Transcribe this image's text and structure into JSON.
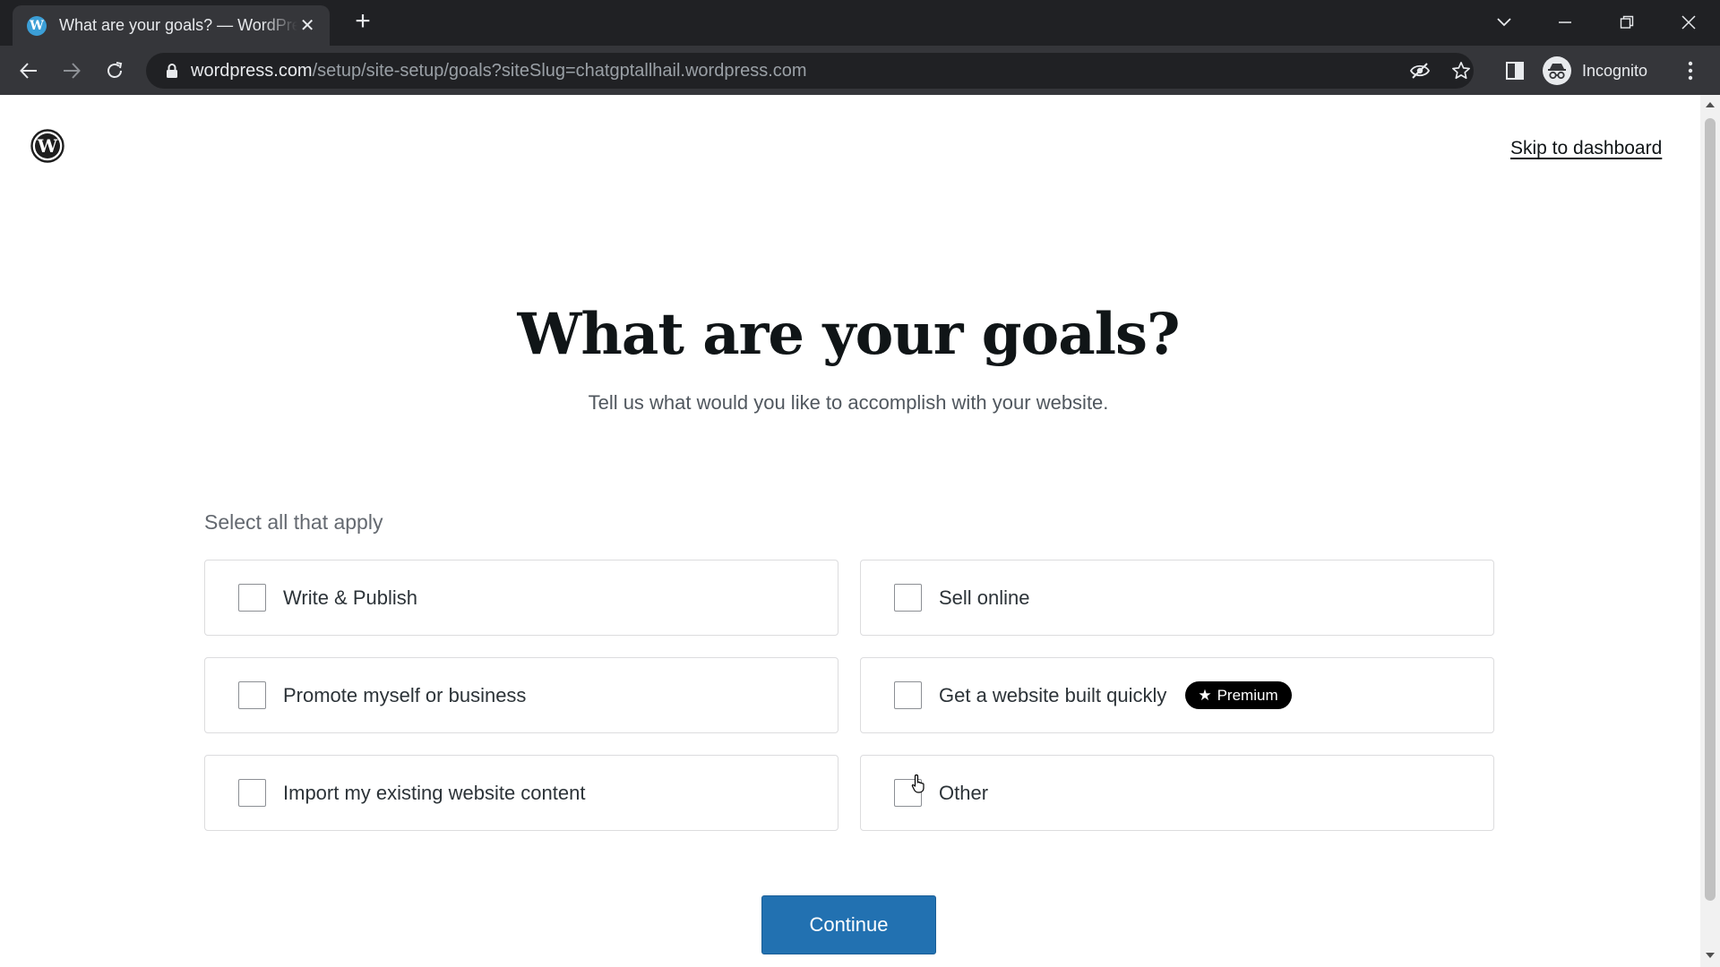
{
  "browser": {
    "tab_title": "What are your goals? — WordPress.com",
    "tab_favicon_letter": "W",
    "url_host": "wordpress.com",
    "url_path": "/setup/site-setup/goals?siteSlug=chatgptallhail.wordpress.com",
    "profile_label": "Incognito",
    "icons": [
      "back-icon",
      "forward-icon",
      "reload-icon",
      "lock-icon",
      "eye-off-icon",
      "star-icon",
      "side-panel-icon",
      "incognito-icon",
      "menu-dots-icon"
    ]
  },
  "header": {
    "skip_label": "Skip to dashboard"
  },
  "main": {
    "title": "What are your goals?",
    "subtitle": "Tell us what would you like to accomplish with your website.",
    "select_label": "Select all that apply",
    "options": [
      {
        "label": "Write & Publish",
        "checked": false
      },
      {
        "label": "Sell online",
        "checked": false
      },
      {
        "label": "Promote myself or business",
        "checked": false
      },
      {
        "label": "Get a website built quickly",
        "checked": false,
        "badge": "Premium"
      },
      {
        "label": "Import my existing website content",
        "checked": false
      },
      {
        "label": "Other",
        "checked": false
      }
    ],
    "continue_label": "Continue"
  },
  "colors": {
    "primary_button": "#2271b1",
    "badge_bg": "#000000",
    "chrome_dark": "#202124",
    "chrome_toolbar": "#35363a"
  }
}
